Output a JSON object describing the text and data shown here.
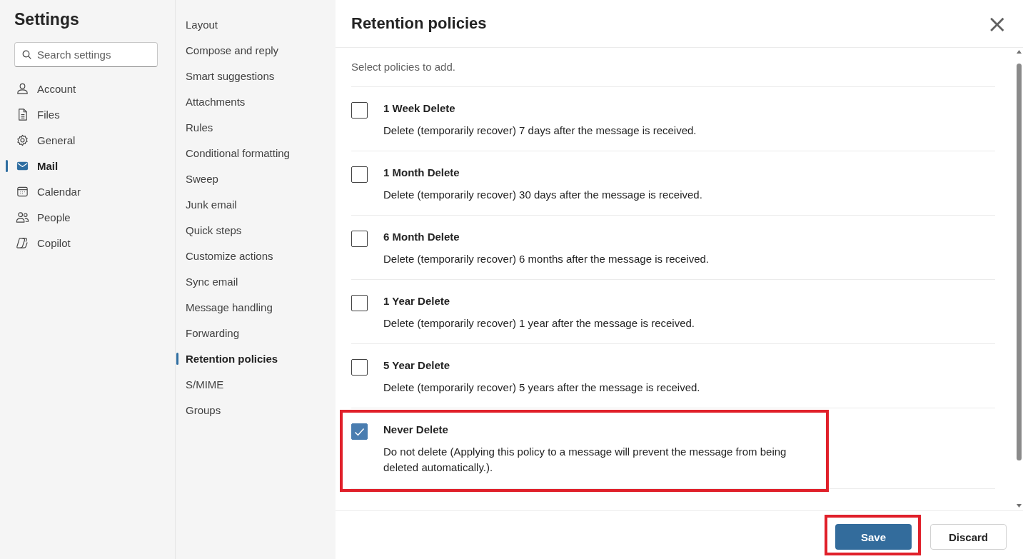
{
  "sidebar": {
    "title": "Settings",
    "search": {
      "placeholder": "Search settings"
    },
    "items": [
      {
        "label": "Account",
        "selected": false
      },
      {
        "label": "Files",
        "selected": false
      },
      {
        "label": "General",
        "selected": false
      },
      {
        "label": "Mail",
        "selected": true
      },
      {
        "label": "Calendar",
        "selected": false
      },
      {
        "label": "People",
        "selected": false
      },
      {
        "label": "Copilot",
        "selected": false
      }
    ]
  },
  "subnav": {
    "items": [
      {
        "label": "Layout",
        "selected": false
      },
      {
        "label": "Compose and reply",
        "selected": false
      },
      {
        "label": "Smart suggestions",
        "selected": false
      },
      {
        "label": "Attachments",
        "selected": false
      },
      {
        "label": "Rules",
        "selected": false
      },
      {
        "label": "Conditional formatting",
        "selected": false
      },
      {
        "label": "Sweep",
        "selected": false
      },
      {
        "label": "Junk email",
        "selected": false
      },
      {
        "label": "Quick steps",
        "selected": false
      },
      {
        "label": "Customize actions",
        "selected": false
      },
      {
        "label": "Sync email",
        "selected": false
      },
      {
        "label": "Message handling",
        "selected": false
      },
      {
        "label": "Forwarding",
        "selected": false
      },
      {
        "label": "Retention policies",
        "selected": true
      },
      {
        "label": "S/MIME",
        "selected": false
      },
      {
        "label": "Groups",
        "selected": false
      }
    ]
  },
  "panel": {
    "title": "Retention policies",
    "close": "×",
    "intro": "Select policies to add.",
    "policies": [
      {
        "name": "1 Week Delete",
        "description": "Delete (temporarily recover) 7 days after the message is received.",
        "checked": false,
        "highlighted": false
      },
      {
        "name": "1 Month Delete",
        "description": "Delete (temporarily recover) 30 days after the message is received.",
        "checked": false,
        "highlighted": false
      },
      {
        "name": "6 Month Delete",
        "description": "Delete (temporarily recover) 6 months after the message is received.",
        "checked": false,
        "highlighted": false
      },
      {
        "name": "1 Year Delete",
        "description": "Delete (temporarily recover) 1 year after the message is received.",
        "checked": false,
        "highlighted": false
      },
      {
        "name": "5 Year Delete",
        "description": "Delete (temporarily recover) 5 years after the message is received.",
        "checked": false,
        "highlighted": false
      },
      {
        "name": "Never Delete",
        "description": "Do not delete (Applying this policy to a message will prevent the message from being deleted automatically.).",
        "checked": true,
        "highlighted": true
      }
    ],
    "buttons": [
      {
        "label": "Save",
        "kind": "primary",
        "highlighted": true
      },
      {
        "label": "Discard",
        "kind": "secondary",
        "highlighted": false
      }
    ]
  }
}
